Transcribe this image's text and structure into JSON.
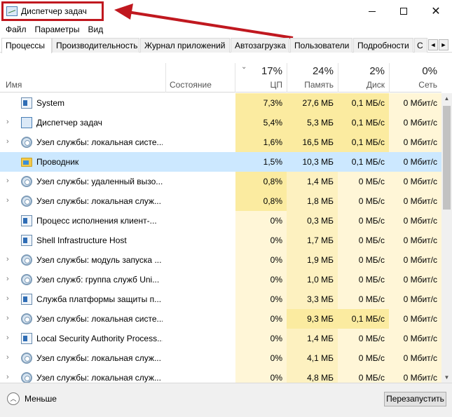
{
  "window": {
    "title": "Диспетчер задач",
    "controls": {
      "minimize": "minimize-icon",
      "maximize": "maximize-icon",
      "close": "✕"
    }
  },
  "menu": [
    "Файл",
    "Параметры",
    "Вид"
  ],
  "tabs": [
    "Процессы",
    "Производительность",
    "Журнал приложений",
    "Автозагрузка",
    "Пользователи",
    "Подробности",
    "С"
  ],
  "active_tab": "Процессы",
  "columns": {
    "name": "Имя",
    "state": "Состояние",
    "cpu": {
      "pct": "17%",
      "label": "ЦП"
    },
    "mem": {
      "pct": "24%",
      "label": "Память"
    },
    "disk": {
      "pct": "2%",
      "label": "Диск"
    },
    "net": {
      "pct": "0%",
      "label": "Сеть"
    }
  },
  "processes": [
    {
      "name": "System",
      "expandable": false,
      "icon": "window-icon",
      "cpu": "7,3%",
      "mem": "27,6 МБ",
      "disk": "0,1 МБ/с",
      "net": "0 Мбит/с"
    },
    {
      "name": "Диспетчер задач",
      "expandable": true,
      "icon": "task-manager-icon",
      "cpu": "5,4%",
      "mem": "5,3 МБ",
      "disk": "0,1 МБ/с",
      "net": "0 Мбит/с"
    },
    {
      "name": "Узел службы: локальная систе...",
      "expandable": true,
      "icon": "gear-icon",
      "cpu": "1,6%",
      "mem": "16,5 МБ",
      "disk": "0,1 МБ/с",
      "net": "0 Мбит/с"
    },
    {
      "name": "Проводник",
      "expandable": false,
      "icon": "folder-icon",
      "cpu": "1,5%",
      "mem": "10,3 МБ",
      "disk": "0,1 МБ/с",
      "net": "0 Мбит/с",
      "selected": true
    },
    {
      "name": "Узел службы: удаленный вызо...",
      "expandable": true,
      "icon": "gear-icon",
      "cpu": "0,8%",
      "mem": "1,4 МБ",
      "disk": "0 МБ/с",
      "net": "0 Мбит/с"
    },
    {
      "name": "Узел службы: локальная служ...",
      "expandable": true,
      "icon": "gear-icon",
      "cpu": "0,8%",
      "mem": "1,8 МБ",
      "disk": "0 МБ/с",
      "net": "0 Мбит/с"
    },
    {
      "name": "Процесс исполнения клиент-...",
      "expandable": false,
      "icon": "window-icon",
      "cpu": "0%",
      "mem": "0,3 МБ",
      "disk": "0 МБ/с",
      "net": "0 Мбит/с"
    },
    {
      "name": "Shell Infrastructure Host",
      "expandable": false,
      "icon": "window-icon",
      "cpu": "0%",
      "mem": "1,7 МБ",
      "disk": "0 МБ/с",
      "net": "0 Мбит/с"
    },
    {
      "name": "Узел службы: модуль запуска ...",
      "expandable": true,
      "icon": "gear-icon",
      "cpu": "0%",
      "mem": "1,9 МБ",
      "disk": "0 МБ/с",
      "net": "0 Мбит/с"
    },
    {
      "name": "Узел служб: группа служб Uni...",
      "expandable": true,
      "icon": "gear-icon",
      "cpu": "0%",
      "mem": "1,0 МБ",
      "disk": "0 МБ/с",
      "net": "0 Мбит/с"
    },
    {
      "name": "Служба платформы защиты п...",
      "expandable": true,
      "icon": "window-icon",
      "cpu": "0%",
      "mem": "3,3 МБ",
      "disk": "0 МБ/с",
      "net": "0 Мбит/с"
    },
    {
      "name": "Узел службы: локальная систе...",
      "expandable": true,
      "icon": "gear-icon",
      "cpu": "0%",
      "mem": "9,3 МБ",
      "disk": "0,1 МБ/с",
      "net": "0 Мбит/с"
    },
    {
      "name": "Local Security Authority Process...",
      "expandable": true,
      "icon": "window-icon",
      "cpu": "0%",
      "mem": "1,4 МБ",
      "disk": "0 МБ/с",
      "net": "0 Мбит/с"
    },
    {
      "name": "Узел службы: локальная служ...",
      "expandable": true,
      "icon": "gear-icon",
      "cpu": "0%",
      "mem": "4,1 МБ",
      "disk": "0 МБ/с",
      "net": "0 Мбит/с"
    },
    {
      "name": "Узел службы: локальная служ...",
      "expandable": true,
      "icon": "gear-icon",
      "cpu": "0%",
      "mem": "4,8 МБ",
      "disk": "0 МБ/с",
      "net": "0 Мбит/с"
    }
  ],
  "footer": {
    "less": "Меньше",
    "restart": "Перезапустить"
  },
  "colors": {
    "heat_strong": "#fbeba0",
    "heat_mid": "#fdf1c0",
    "heat_light": "#fff6d7",
    "selected_row": "#cce8ff",
    "annotation": "#c0181f"
  }
}
